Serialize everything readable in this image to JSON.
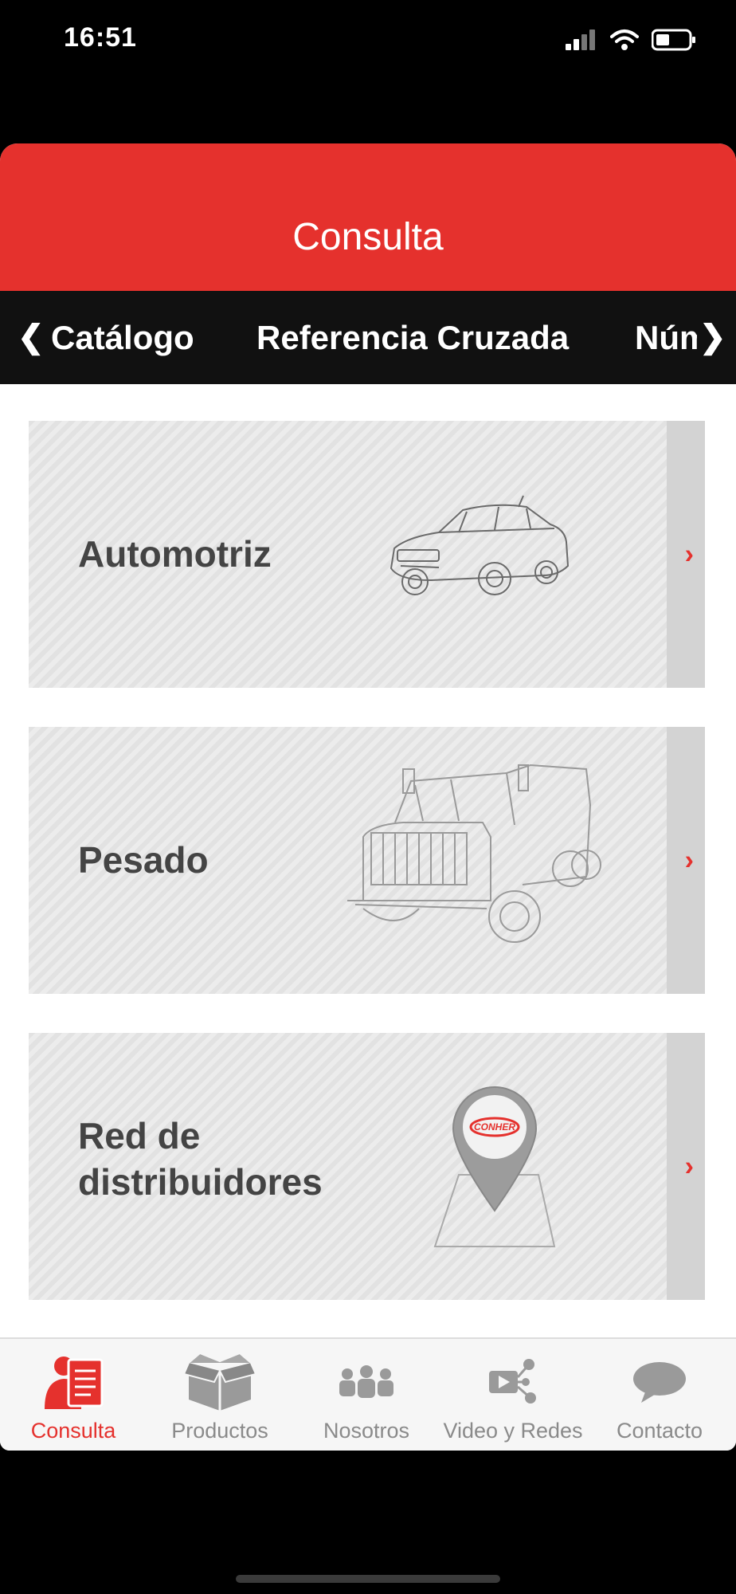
{
  "status": {
    "time": "16:51"
  },
  "header": {
    "title": "Consulta"
  },
  "tabs": {
    "left_arrow": "❮",
    "right_arrow": "❯",
    "items": [
      {
        "label": "Catálogo",
        "active": true
      },
      {
        "label": "Referencia Cruzada",
        "active": false
      },
      {
        "label": "Núm",
        "active": false
      }
    ]
  },
  "cards": [
    {
      "label": "Automotriz",
      "image": "car-illustration"
    },
    {
      "label": "Pesado",
      "image": "truck-illustration"
    },
    {
      "label_line1": "Red de",
      "label_line2": "distribuidores",
      "image": "map-pin-illustration",
      "logo_text": "CONHER"
    }
  ],
  "card_chevron": "›",
  "bottom_nav": [
    {
      "label": "Consulta",
      "icon": "document-person-icon",
      "active": true
    },
    {
      "label": "Productos",
      "icon": "box-icon",
      "active": false
    },
    {
      "label": "Nosotros",
      "icon": "people-icon",
      "active": false
    },
    {
      "label": "Video y Redes",
      "icon": "video-share-icon",
      "active": false
    },
    {
      "label": "Contacto",
      "icon": "speech-bubble-icon",
      "active": false
    }
  ],
  "colors": {
    "accent": "#e5312d",
    "tabbar": "#111111",
    "card": "#e6e6e6",
    "inactive": "#8a8a8a"
  }
}
